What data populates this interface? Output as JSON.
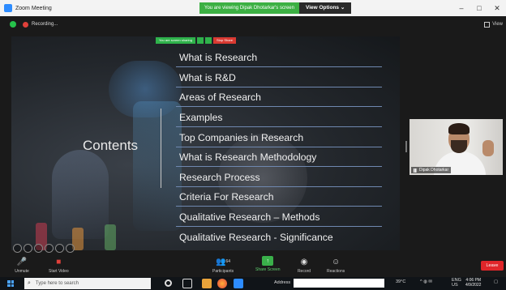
{
  "window": {
    "title": "Zoom Meeting",
    "share_notice": "You are viewing Dipak Dhotarkar's screen",
    "view_options": "View Options ⌄",
    "controls": [
      "–",
      "□",
      "✕"
    ]
  },
  "meeting": {
    "recording": "Recording...",
    "view": "View"
  },
  "share_controls": {
    "label": "You are screen sharing",
    "stop": "Stop Share"
  },
  "slide": {
    "title": "Contents",
    "items": [
      "What is Research",
      "What is R&D",
      "Areas of Research",
      "Examples",
      "Top Companies in Research",
      "What is Research Methodology",
      "Research Process",
      "Criteria For Research",
      "Qualitative Research – Methods",
      "Qualitative Research - Significance"
    ]
  },
  "participant": {
    "name": "Dipak Dhotarkar"
  },
  "toolbar": {
    "unmute": "Unmute",
    "start_video": "Start Video",
    "participants": "Participants",
    "participants_count": "64",
    "share_screen": "Share Screen",
    "record": "Record",
    "reactions": "Reactions",
    "leave": "Leave"
  },
  "taskbar": {
    "search_placeholder": "Type here to search",
    "address_label": "Address",
    "weather": "39°C",
    "language": "ENG",
    "region": "US",
    "time": "4:06 PM",
    "date": "4/9/2022"
  }
}
